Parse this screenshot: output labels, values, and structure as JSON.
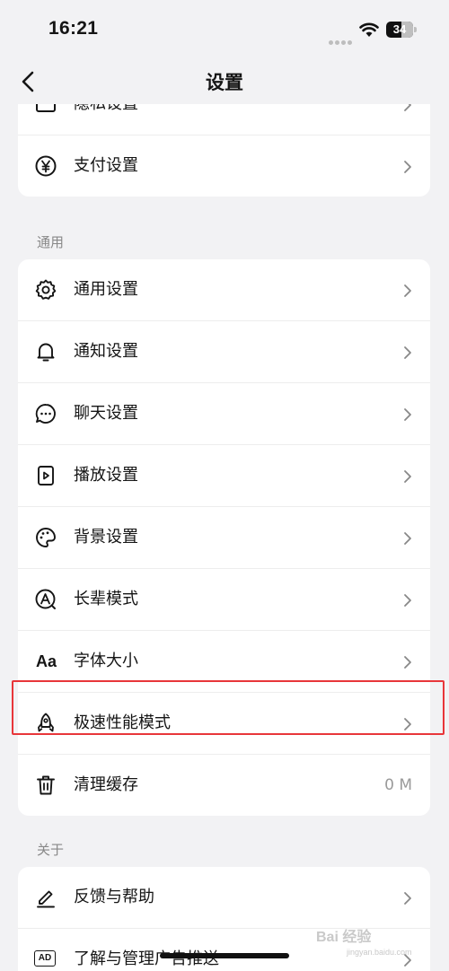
{
  "status_bar": {
    "time": "16:21",
    "battery": "34"
  },
  "nav": {
    "title": "设置"
  },
  "top_group": [
    {
      "label": "隐私设置",
      "icon": "privacy-icon"
    },
    {
      "label": "支付设置",
      "icon": "yen-icon"
    }
  ],
  "general": {
    "title": "通用",
    "items": [
      {
        "label": "通用设置",
        "icon": "gear-icon"
      },
      {
        "label": "通知设置",
        "icon": "bell-icon"
      },
      {
        "label": "聊天设置",
        "icon": "chat-bubble-icon"
      },
      {
        "label": "播放设置",
        "icon": "play-file-icon"
      },
      {
        "label": "背景设置",
        "icon": "palette-icon"
      },
      {
        "label": "长辈模式",
        "icon": "elder-mode-icon"
      },
      {
        "label": "字体大小",
        "icon": "font-size-icon",
        "icon_text": "Aa"
      },
      {
        "label": "极速性能模式",
        "icon": "rocket-icon"
      },
      {
        "label": "清理缓存",
        "icon": "trash-icon",
        "value": "0 M"
      }
    ]
  },
  "about": {
    "title": "关于",
    "items": [
      {
        "label": "反馈与帮助",
        "icon": "pencil-icon"
      },
      {
        "label": "了解与管理广告推送",
        "icon": "ad-icon",
        "icon_text": "AD"
      }
    ]
  },
  "watermark": {
    "text": "Bai 经验",
    "sub": "jingyan.baidu.com"
  },
  "colors": {
    "highlight": "#e8363a",
    "background": "#f2f2f4"
  }
}
